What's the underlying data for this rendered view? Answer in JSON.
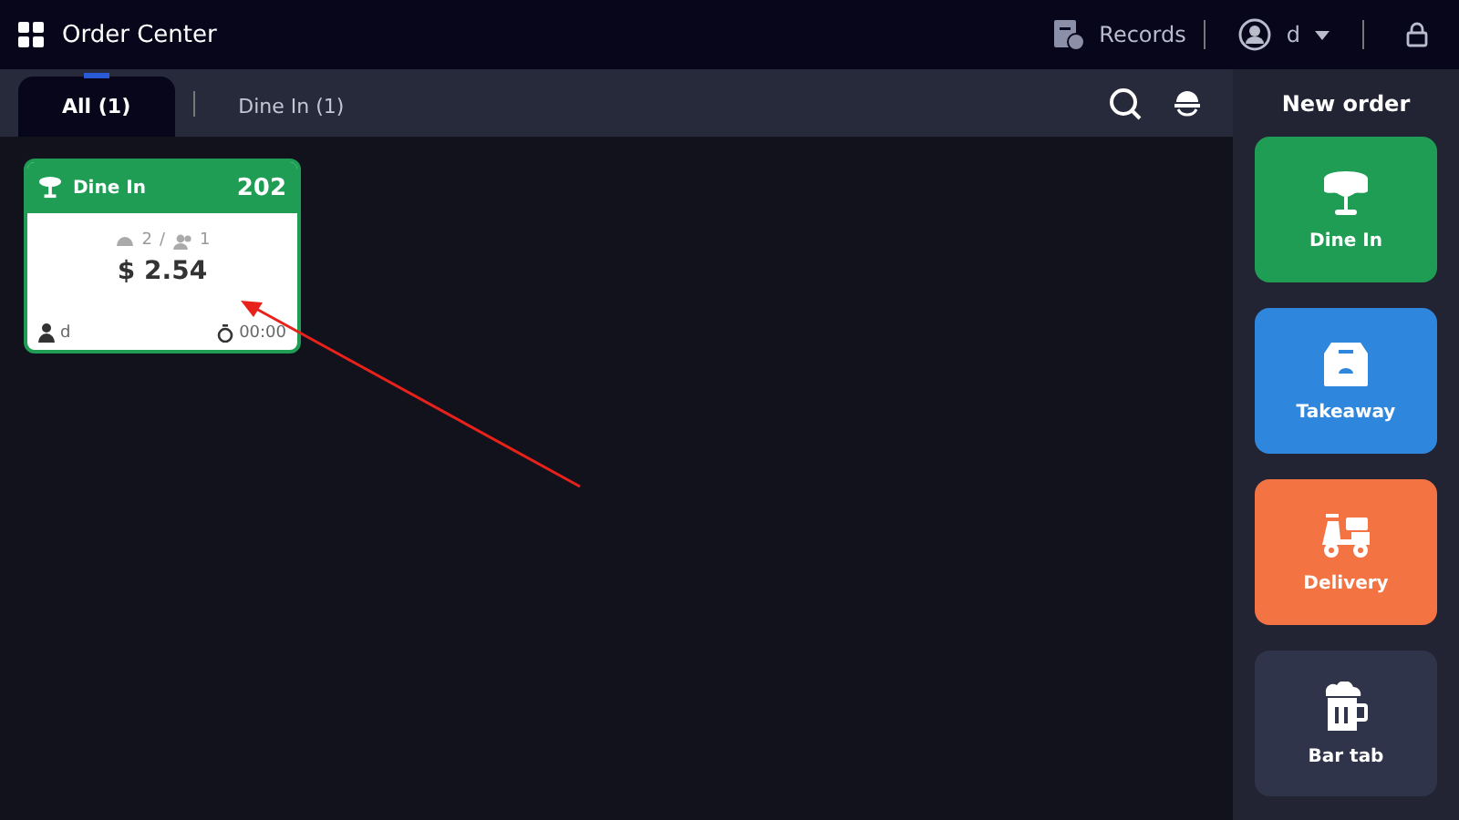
{
  "header": {
    "title": "Order Center",
    "records": "Records",
    "user": "d"
  },
  "tabs": [
    {
      "label": "All (1)",
      "selected": true
    },
    {
      "label": "Dine In (1)",
      "selected": false
    }
  ],
  "orders": [
    {
      "type": "Dine In",
      "table": "202",
      "dishes": "2",
      "separator": "/",
      "guests": "1",
      "total": "$ 2.54",
      "staff": "d",
      "timer": "00:00",
      "color": "#1f9d55"
    }
  ],
  "new_order": {
    "title": "New order",
    "buttons": [
      {
        "kind": "dine-in",
        "label": "Dine In",
        "color": "#1f9d55"
      },
      {
        "kind": "takeaway",
        "label": "Takeaway",
        "color": "#2f86dd"
      },
      {
        "kind": "delivery",
        "label": "Delivery",
        "color": "#f47342"
      },
      {
        "kind": "bar-tab",
        "label": "Bar tab",
        "color": "#30344a"
      }
    ]
  }
}
